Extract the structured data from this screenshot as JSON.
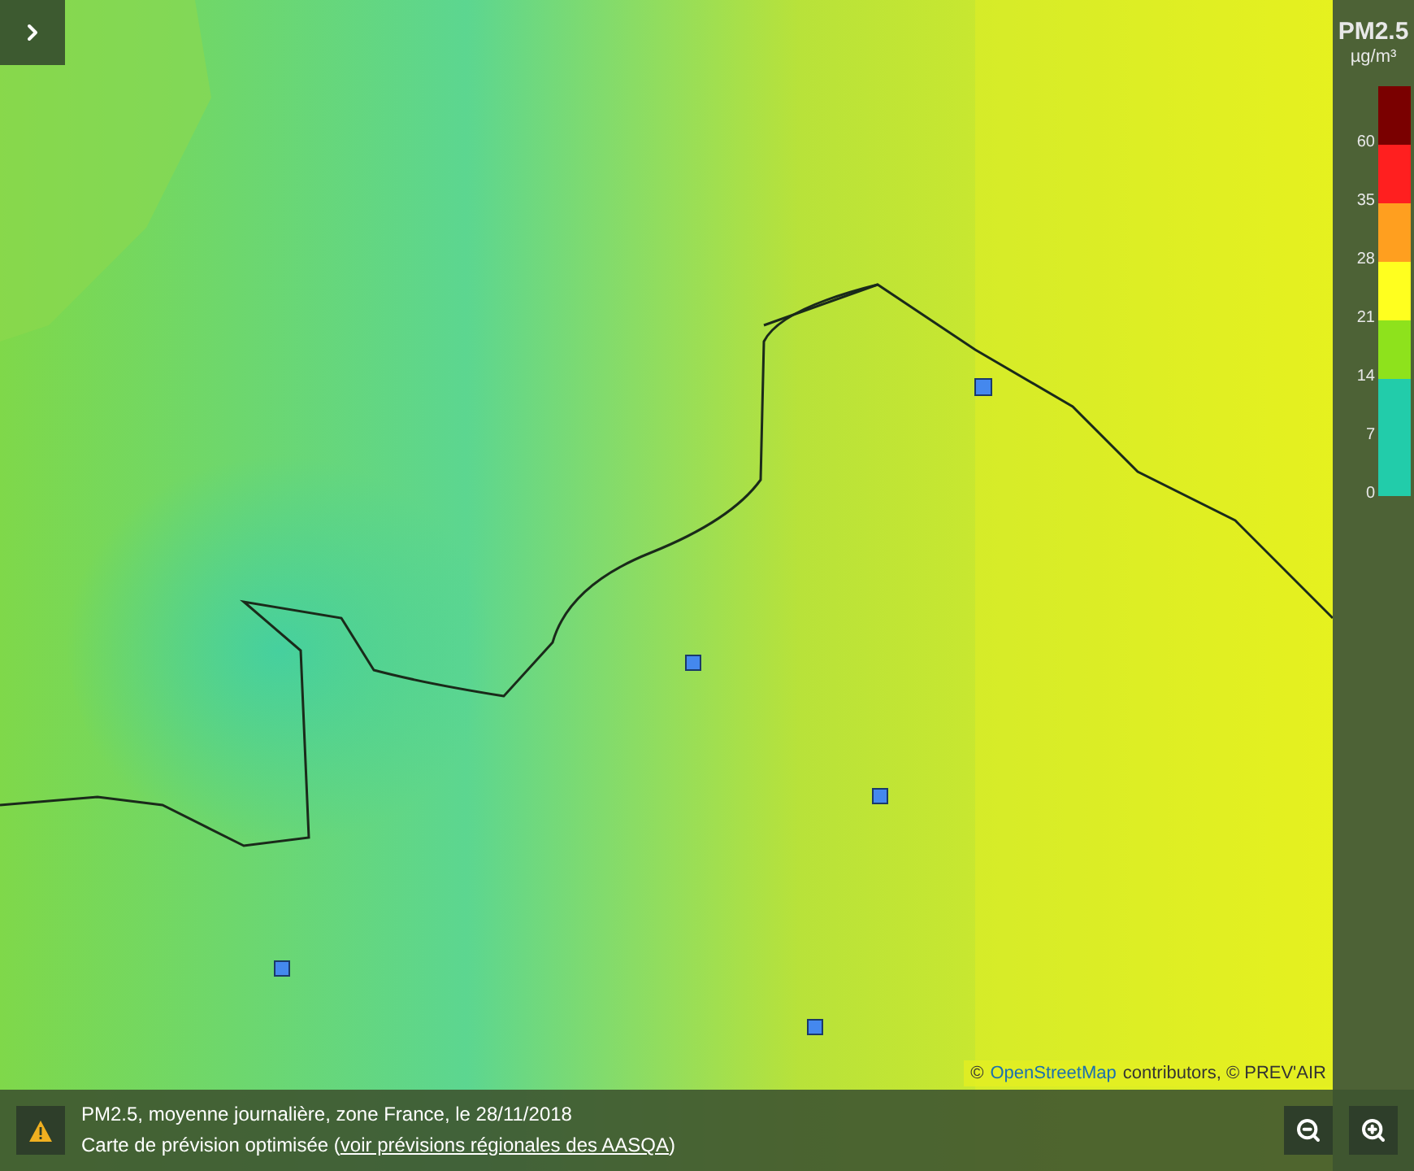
{
  "legend": {
    "title": "PM2.5",
    "unit": "µg/m³",
    "bands": [
      {
        "color": "#7a0000",
        "label": "60"
      },
      {
        "color": "#ff1f1f",
        "label": "35"
      },
      {
        "color": "#ff9f1f",
        "label": "28"
      },
      {
        "color": "#ffff1f",
        "label": "21"
      },
      {
        "color": "#8ee21c",
        "label": "14"
      },
      {
        "color": "#22ccaa",
        "label": "7"
      },
      {
        "color": "#22ccaa",
        "label": "0"
      }
    ]
  },
  "attribution": {
    "prefix": "©",
    "link": "OpenStreetMap",
    "suffix": "contributors, © PREV'AIR"
  },
  "info_bar": {
    "line_1": "PM2.5, moyenne journalière, zone France, le 28/11/2018",
    "line_2_text": "Carte de prévision optimisée (",
    "line_2_link": "voir prévisions régionales des AASQA",
    "line_2_end": ")"
  }
}
